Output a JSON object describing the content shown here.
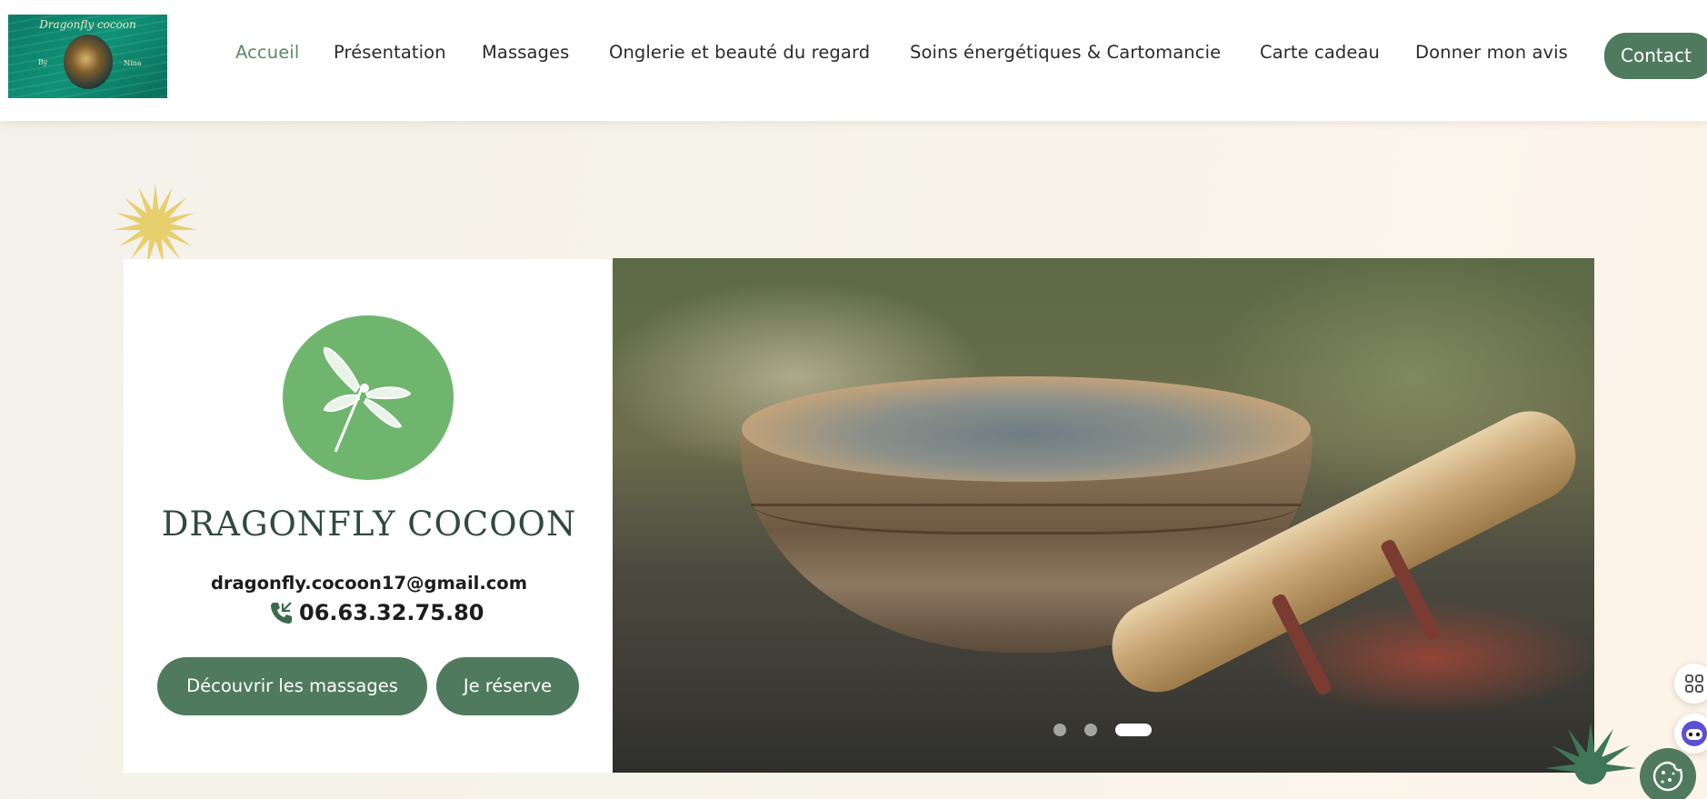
{
  "header": {
    "logo": {
      "title": "Dragonfly cocoon",
      "by": "By",
      "author": "Nina"
    },
    "nav": [
      {
        "label": "Accueil",
        "active": true
      },
      {
        "label": "Présentation",
        "active": false
      },
      {
        "label": "Massages",
        "active": false
      },
      {
        "label": "Onglerie et beauté du regard",
        "active": false
      },
      {
        "label": "Soins énergétiques & Cartomancie",
        "active": false
      },
      {
        "label": "Carte cadeau",
        "active": false
      },
      {
        "label": "Donner mon avis",
        "active": false
      }
    ],
    "contact_label": "Contact"
  },
  "hero": {
    "brand": "DRAGONFLY COCOON",
    "email": "dragonfly.cocoon17@gmail.com",
    "phone": "06.63.32.75.80",
    "buttons": {
      "discover": "Découvrir les massages",
      "book": "Je réserve"
    },
    "slider": {
      "image": "singing-bowl-with-mallet",
      "slide_count": 3,
      "active_slide": 3
    }
  },
  "widgets": {
    "icons": [
      "apps-grid-icon",
      "chat-robot-icon",
      "cookie-icon"
    ]
  },
  "colors": {
    "primary_green": "#4f7a5e",
    "active_nav": "#5d8a67",
    "logo_circle": "#6fb56e",
    "brand_text": "#2f4a40"
  }
}
